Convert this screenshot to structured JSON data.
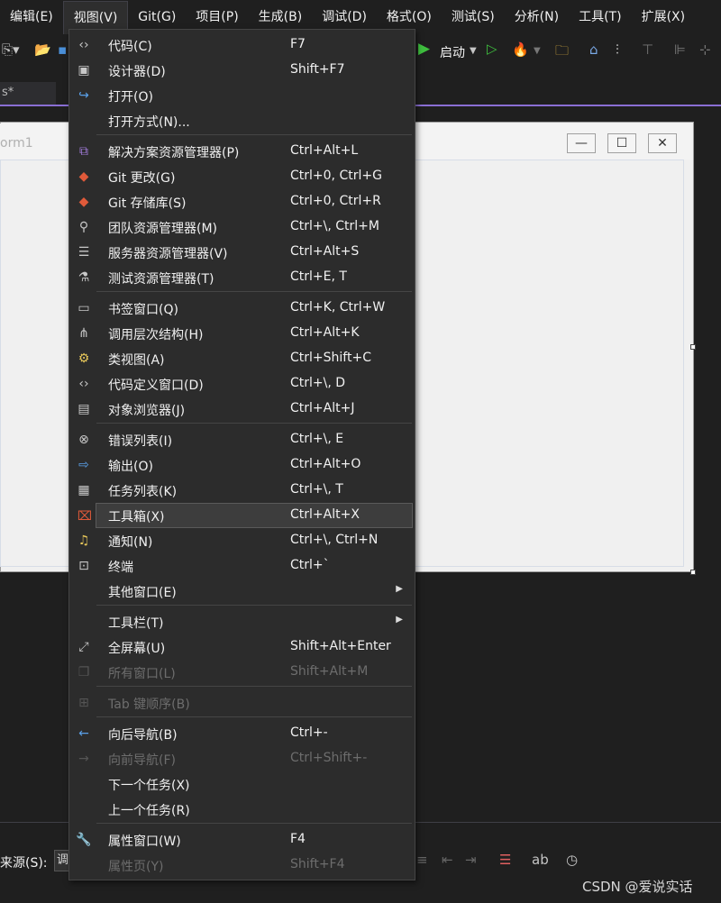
{
  "menubar": {
    "items": [
      "编辑(E)",
      "视图(V)",
      "Git(G)",
      "项目(P)",
      "生成(B)",
      "调试(D)",
      "格式(O)",
      "测试(S)",
      "分析(N)",
      "工具(T)",
      "扩展(X)"
    ]
  },
  "toolbar": {
    "start_label": "启动"
  },
  "doc_tab": {
    "label": "s*"
  },
  "form": {
    "title": "orm1",
    "min": "—",
    "max": "☐",
    "close": "✕"
  },
  "view_menu": {
    "items": [
      {
        "icon": "code-icon",
        "glyph": "‹›",
        "label": "代码(C)",
        "shortcut": "F7"
      },
      {
        "icon": "designer-icon",
        "glyph": "▣",
        "label": "设计器(D)",
        "shortcut": "Shift+F7"
      },
      {
        "icon": "open-icon",
        "glyph": "↪",
        "label": "打开(O)",
        "shortcut": ""
      },
      {
        "icon": "",
        "glyph": "",
        "label": "打开方式(N)...",
        "shortcut": ""
      },
      {
        "icon": "solution-explorer-icon",
        "glyph": "⧉",
        "label": "解决方案资源管理器(P)",
        "shortcut": "Ctrl+Alt+L"
      },
      {
        "icon": "git-changes-icon",
        "glyph": "◆",
        "label": "Git 更改(G)",
        "shortcut": "Ctrl+0, Ctrl+G"
      },
      {
        "icon": "git-repo-icon",
        "glyph": "◆",
        "label": "Git 存储库(S)",
        "shortcut": "Ctrl+0, Ctrl+R"
      },
      {
        "icon": "team-explorer-icon",
        "glyph": "⚲",
        "label": "团队资源管理器(M)",
        "shortcut": "Ctrl+\\, Ctrl+M"
      },
      {
        "icon": "server-explorer-icon",
        "glyph": "☰",
        "label": "服务器资源管理器(V)",
        "shortcut": "Ctrl+Alt+S"
      },
      {
        "icon": "test-explorer-icon",
        "glyph": "⚗",
        "label": "测试资源管理器(T)",
        "shortcut": "Ctrl+E, T"
      },
      {
        "icon": "bookmark-icon",
        "glyph": "▭",
        "label": "书签窗口(Q)",
        "shortcut": "Ctrl+K, Ctrl+W"
      },
      {
        "icon": "call-hierarchy-icon",
        "glyph": "⋔",
        "label": "调用层次结构(H)",
        "shortcut": "Ctrl+Alt+K"
      },
      {
        "icon": "class-view-icon",
        "glyph": "⚙",
        "label": "类视图(A)",
        "shortcut": "Ctrl+Shift+C"
      },
      {
        "icon": "code-definition-icon",
        "glyph": "‹›",
        "label": "代码定义窗口(D)",
        "shortcut": "Ctrl+\\, D"
      },
      {
        "icon": "object-browser-icon",
        "glyph": "▤",
        "label": "对象浏览器(J)",
        "shortcut": "Ctrl+Alt+J"
      },
      {
        "icon": "error-list-icon",
        "glyph": "⊗",
        "label": "错误列表(I)",
        "shortcut": "Ctrl+\\, E"
      },
      {
        "icon": "output-icon",
        "glyph": "⇨",
        "label": "输出(O)",
        "shortcut": "Ctrl+Alt+O"
      },
      {
        "icon": "task-list-icon",
        "glyph": "▦",
        "label": "任务列表(K)",
        "shortcut": "Ctrl+\\, T"
      },
      {
        "icon": "toolbox-icon",
        "glyph": "⌧",
        "label": "工具箱(X)",
        "shortcut": "Ctrl+Alt+X"
      },
      {
        "icon": "bell-icon",
        "glyph": "♫",
        "label": "通知(N)",
        "shortcut": "Ctrl+\\, Ctrl+N"
      },
      {
        "icon": "terminal-icon",
        "glyph": "⊡",
        "label": "终端",
        "shortcut": "Ctrl+`"
      },
      {
        "icon": "",
        "glyph": "",
        "label": "其他窗口(E)",
        "shortcut": ""
      },
      {
        "icon": "",
        "glyph": "",
        "label": "工具栏(T)",
        "shortcut": ""
      },
      {
        "icon": "fullscreen-icon",
        "glyph": "⤢",
        "label": "全屏幕(U)",
        "shortcut": "Shift+Alt+Enter"
      },
      {
        "icon": "all-windows-icon",
        "glyph": "❐",
        "label": "所有窗口(L)",
        "shortcut": "Shift+Alt+M"
      },
      {
        "icon": "tab-order-icon",
        "glyph": "⊞",
        "label": "Tab 键顺序(B)",
        "shortcut": ""
      },
      {
        "icon": "navigate-back-icon",
        "glyph": "←",
        "label": "向后导航(B)",
        "shortcut": "Ctrl+-"
      },
      {
        "icon": "navigate-forward-icon",
        "glyph": "→",
        "label": "向前导航(F)",
        "shortcut": "Ctrl+Shift+-"
      },
      {
        "icon": "",
        "glyph": "",
        "label": "下一个任务(X)",
        "shortcut": ""
      },
      {
        "icon": "",
        "glyph": "",
        "label": "上一个任务(R)",
        "shortcut": ""
      },
      {
        "icon": "wrench-icon",
        "glyph": "🔧",
        "label": "属性窗口(W)",
        "shortcut": "F4"
      },
      {
        "icon": "",
        "glyph": "",
        "label": "属性页(Y)",
        "shortcut": "Shift+F4"
      }
    ],
    "disabled": [
      "所有窗口(L)",
      "Tab 键顺序(B)",
      "向前导航(F)",
      "属性页(Y)"
    ],
    "highlighted": "工具箱(X)"
  },
  "bottom": {
    "source_label": "来源(S):",
    "source_value": "调"
  },
  "watermark": "CSDN @爱说实话",
  "colors": {
    "accent": "#8a6fd4",
    "play": "#3fbf3f"
  }
}
